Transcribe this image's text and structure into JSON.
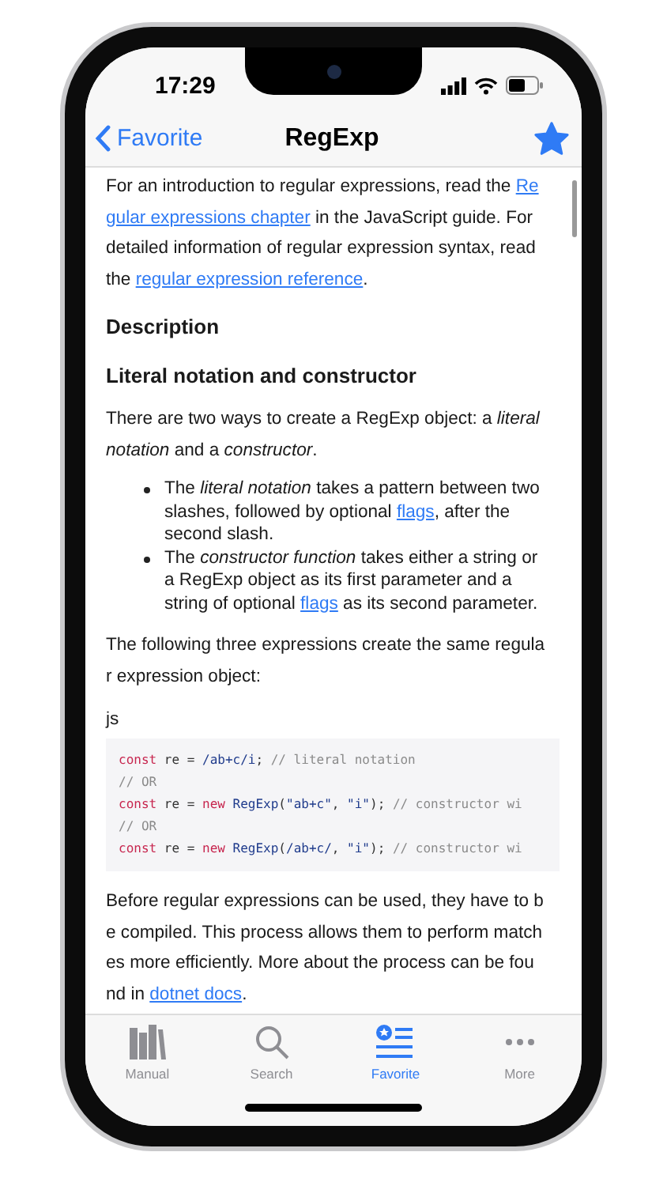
{
  "status_bar": {
    "time": "17:29"
  },
  "nav": {
    "back": "Favorite",
    "title": "RegExp",
    "favorited": true
  },
  "content": [
    {
      "kind": "paragraph",
      "lines": [
        [
          {
            "kind": "text",
            "text": "For an introduction to regular expressions, read the "
          },
          {
            "kind": "link",
            "text": "Re"
          }
        ],
        [
          {
            "kind": "link",
            "text": "gular expressions chapter"
          },
          {
            "kind": "text",
            "text": " in the JavaScript guide. For"
          }
        ],
        [
          {
            "kind": "text",
            "text": "detailed information of regular expression syntax, read"
          }
        ],
        [
          {
            "kind": "text",
            "text": "the "
          },
          {
            "kind": "link",
            "text": "regular expression reference"
          },
          {
            "kind": "text",
            "text": "."
          }
        ]
      ]
    },
    {
      "kind": "heading",
      "text": "Description"
    },
    {
      "kind": "heading",
      "text": "Literal notation and constructor"
    },
    {
      "kind": "paragraph",
      "lines": [
        [
          {
            "kind": "text",
            "text": "There are two ways to create a RegExp object: a "
          },
          {
            "kind": "italic",
            "text": "literal"
          }
        ],
        [
          {
            "kind": "italic",
            "text": "notation"
          },
          {
            "kind": "text",
            "text": " and a "
          },
          {
            "kind": "italic",
            "text": "constructor"
          },
          {
            "kind": "text",
            "text": "."
          }
        ]
      ]
    },
    {
      "kind": "bullets",
      "items": [
        [
          {
            "kind": "text",
            "text": "The "
          },
          {
            "kind": "italic",
            "text": "literal notation"
          },
          {
            "kind": "text",
            "text": " takes a pattern between two slashes, followed by optional "
          },
          {
            "kind": "link",
            "text": "flags"
          },
          {
            "kind": "text",
            "text": ", after the second slash."
          }
        ],
        [
          {
            "kind": "text",
            "text": "The "
          },
          {
            "kind": "italic",
            "text": "constructor function"
          },
          {
            "kind": "text",
            "text": " takes either a string or a RegExp object as its first parameter and a string of optional "
          },
          {
            "kind": "link",
            "text": "flags"
          },
          {
            "kind": "text",
            "text": " as its second parameter."
          }
        ]
      ]
    },
    {
      "kind": "paragraph",
      "lines": [
        [
          {
            "kind": "text",
            "text": "The following three expressions create the same regula"
          }
        ],
        [
          {
            "kind": "text",
            "text": "r expression object:"
          }
        ]
      ]
    },
    {
      "kind": "label",
      "text": "js"
    },
    {
      "kind": "code",
      "lines": [
        [
          {
            "kind": "keyword",
            "text": "const"
          },
          {
            "kind": "plain",
            "text": " re = "
          },
          {
            "kind": "regex",
            "text": "/ab+c/i"
          },
          {
            "kind": "plain",
            "text": "; "
          },
          {
            "kind": "comment",
            "text": "// literal notation"
          }
        ],
        [
          {
            "kind": "comment",
            "text": "// OR"
          }
        ],
        [
          {
            "kind": "keyword",
            "text": "const"
          },
          {
            "kind": "plain",
            "text": " re = "
          },
          {
            "kind": "keyword",
            "text": "new"
          },
          {
            "kind": "func",
            "text": " RegExp"
          },
          {
            "kind": "plain",
            "text": "("
          },
          {
            "kind": "string",
            "text": "\"ab+c\""
          },
          {
            "kind": "plain",
            "text": ", "
          },
          {
            "kind": "string",
            "text": "\"i\""
          },
          {
            "kind": "plain",
            "text": "); "
          },
          {
            "kind": "comment",
            "text": "// constructor wi"
          }
        ],
        [
          {
            "kind": "comment",
            "text": "// OR"
          }
        ],
        [
          {
            "kind": "keyword",
            "text": "const"
          },
          {
            "kind": "plain",
            "text": " re = "
          },
          {
            "kind": "keyword",
            "text": "new"
          },
          {
            "kind": "func",
            "text": " RegExp"
          },
          {
            "kind": "plain",
            "text": "("
          },
          {
            "kind": "regex",
            "text": "/ab+c/"
          },
          {
            "kind": "plain",
            "text": ", "
          },
          {
            "kind": "string",
            "text": "\"i\""
          },
          {
            "kind": "plain",
            "text": "); "
          },
          {
            "kind": "comment",
            "text": "// constructor wi"
          }
        ]
      ]
    },
    {
      "kind": "paragraph",
      "lines": [
        [
          {
            "kind": "text",
            "text": "Before regular expressions can be used, they have to b"
          }
        ],
        [
          {
            "kind": "text",
            "text": "e compiled. This process allows them to perform match"
          }
        ],
        [
          {
            "kind": "text",
            "text": "es more efficiently. More about the process can be fou"
          }
        ],
        [
          {
            "kind": "text",
            "text": "nd in "
          },
          {
            "kind": "link",
            "text": "dotnet docs"
          },
          {
            "kind": "text",
            "text": "."
          }
        ]
      ]
    }
  ],
  "tabs": [
    {
      "kind": "books",
      "label": "Manual",
      "selected": false
    },
    {
      "kind": "search",
      "label": "Search",
      "selected": false
    },
    {
      "kind": "favorites",
      "label": "Favorite",
      "selected": true
    },
    {
      "kind": "more",
      "label": "More",
      "selected": false
    }
  ]
}
